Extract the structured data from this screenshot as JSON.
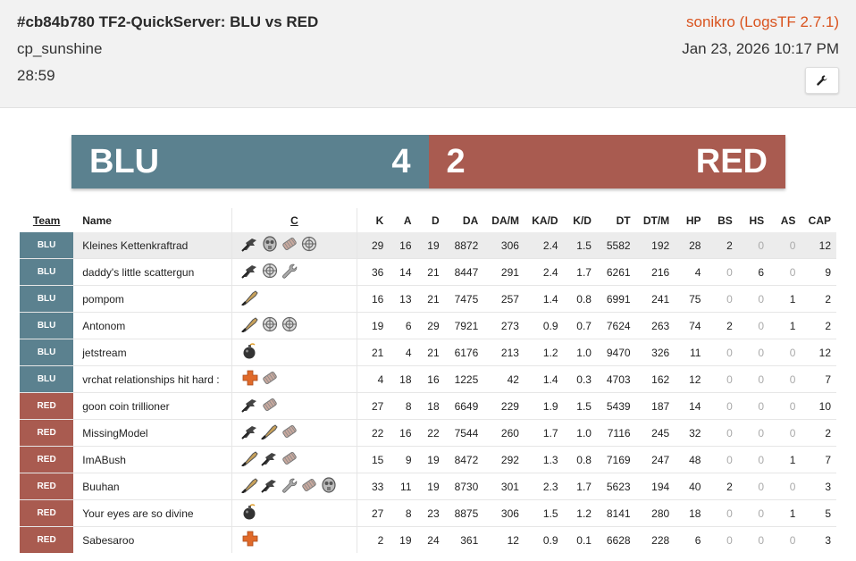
{
  "header": {
    "title": "#cb84b780 TF2-QuickServer: BLU vs RED",
    "map": "cp_sunshine",
    "duration": "28:59",
    "uploader": "sonikro (LogsTF 2.7.1)",
    "date": "Jan 23, 2026 10:17 PM",
    "tool_icon": "wrench-icon"
  },
  "score": {
    "blu_name": "BLU",
    "blu_score": "4",
    "red_name": "RED",
    "red_score": "2",
    "blu_color": "#5b818f",
    "red_color": "#a95b50"
  },
  "columns": [
    "Team",
    "Name",
    "C",
    "K",
    "A",
    "D",
    "DA",
    "DA/M",
    "KA/D",
    "K/D",
    "DT",
    "DT/M",
    "HP",
    "BS",
    "HS",
    "AS",
    "CAP"
  ],
  "players": [
    {
      "team": "BLU",
      "name": "Kleines Kettenkraftrad",
      "classes": [
        "scout",
        "pyro",
        "heavy",
        "engineer"
      ],
      "stats": [
        "29",
        "16",
        "19",
        "8872",
        "306",
        "2.4",
        "1.5",
        "5582",
        "192",
        "28",
        "2",
        "0",
        "0",
        "12"
      ]
    },
    {
      "team": "BLU",
      "name": "daddy's little scattergun",
      "classes": [
        "scout",
        "engineer",
        "wrench"
      ],
      "stats": [
        "36",
        "14",
        "21",
        "8447",
        "291",
        "2.4",
        "1.7",
        "6261",
        "216",
        "4",
        "0",
        "6",
        "0",
        "9"
      ]
    },
    {
      "team": "BLU",
      "name": "pompom",
      "classes": [
        "sniper"
      ],
      "stats": [
        "16",
        "13",
        "21",
        "7475",
        "257",
        "1.4",
        "0.8",
        "6991",
        "241",
        "75",
        "0",
        "0",
        "1",
        "2"
      ]
    },
    {
      "team": "BLU",
      "name": "Antonom",
      "classes": [
        "sniper",
        "engineer",
        "engineer"
      ],
      "stats": [
        "19",
        "6",
        "29",
        "7921",
        "273",
        "0.9",
        "0.7",
        "7624",
        "263",
        "74",
        "2",
        "0",
        "1",
        "2"
      ]
    },
    {
      "team": "BLU",
      "name": "jetstream",
      "classes": [
        "demoman"
      ],
      "stats": [
        "21",
        "4",
        "21",
        "6176",
        "213",
        "1.2",
        "1.0",
        "9470",
        "326",
        "11",
        "0",
        "0",
        "0",
        "12"
      ]
    },
    {
      "team": "BLU",
      "name": "vrchat relationships hit hard :",
      "classes": [
        "medic",
        "heavy"
      ],
      "stats": [
        "4",
        "18",
        "16",
        "1225",
        "42",
        "1.4",
        "0.3",
        "4703",
        "162",
        "12",
        "0",
        "0",
        "0",
        "7"
      ]
    },
    {
      "team": "RED",
      "name": "goon coin trillioner",
      "classes": [
        "scout",
        "heavy"
      ],
      "stats": [
        "27",
        "8",
        "18",
        "6649",
        "229",
        "1.9",
        "1.5",
        "5439",
        "187",
        "14",
        "0",
        "0",
        "0",
        "10"
      ]
    },
    {
      "team": "RED",
      "name": "MissingModel",
      "classes": [
        "scout",
        "sniper",
        "heavy"
      ],
      "stats": [
        "22",
        "16",
        "22",
        "7544",
        "260",
        "1.7",
        "1.0",
        "7116",
        "245",
        "32",
        "0",
        "0",
        "0",
        "2"
      ]
    },
    {
      "team": "RED",
      "name": "ImABush",
      "classes": [
        "sniper",
        "scout",
        "heavy"
      ],
      "stats": [
        "15",
        "9",
        "19",
        "8472",
        "292",
        "1.3",
        "0.8",
        "7169",
        "247",
        "48",
        "0",
        "0",
        "1",
        "7"
      ]
    },
    {
      "team": "RED",
      "name": "Buuhan",
      "classes": [
        "sniper",
        "scout",
        "wrench",
        "heavy",
        "pyro"
      ],
      "stats": [
        "33",
        "11",
        "19",
        "8730",
        "301",
        "2.3",
        "1.7",
        "5623",
        "194",
        "40",
        "2",
        "0",
        "0",
        "3"
      ]
    },
    {
      "team": "RED",
      "name": "Your eyes are so divine",
      "classes": [
        "demoman"
      ],
      "stats": [
        "27",
        "8",
        "23",
        "8875",
        "306",
        "1.5",
        "1.2",
        "8141",
        "280",
        "18",
        "0",
        "0",
        "1",
        "5"
      ]
    },
    {
      "team": "RED",
      "name": "Sabesaroo",
      "classes": [
        "medic"
      ],
      "stats": [
        "2",
        "19",
        "24",
        "361",
        "12",
        "0.9",
        "0.1",
        "6628",
        "228",
        "6",
        "0",
        "0",
        "0",
        "3"
      ]
    }
  ]
}
